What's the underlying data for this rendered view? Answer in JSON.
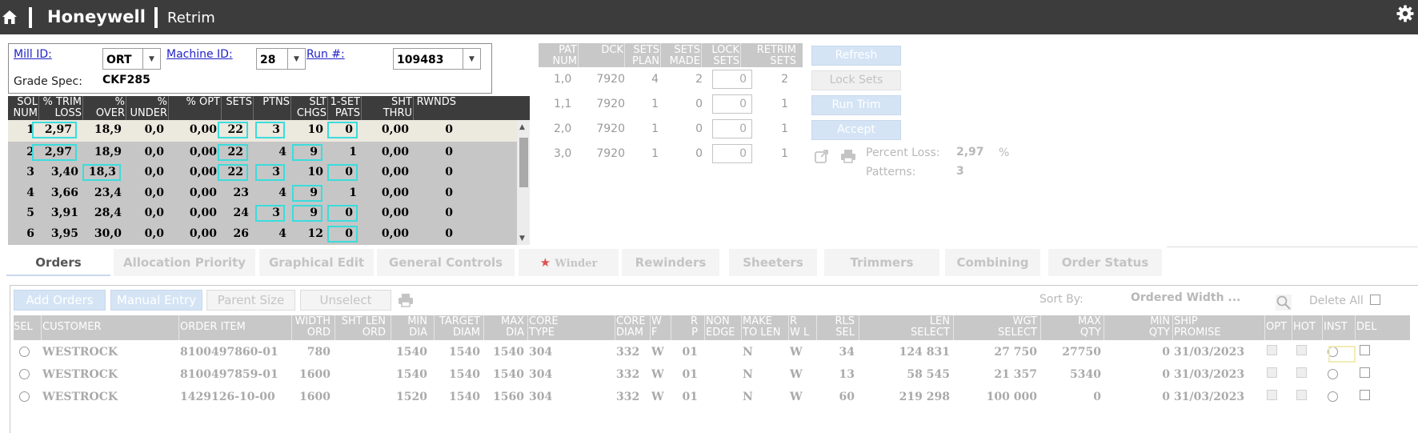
{
  "app": {
    "brand": "Honeywell",
    "title": "Retrim"
  },
  "icons": {
    "home": "home-icon",
    "settings": "gear-icon",
    "export": "export-icon",
    "print": "printer-icon",
    "search": "search-icon"
  },
  "header": {
    "mill_label": "Mill ID:",
    "mill_value": "ORT",
    "machine_label": "Machine ID:",
    "machine_value": "28",
    "run_label": "Run #:",
    "run_value": "109483",
    "grade_label": "Grade Spec:",
    "grade_value": "CKF285"
  },
  "solutions": {
    "columns": [
      {
        "l1": "SOL",
        "l2": "NUM"
      },
      {
        "l1": "% TRIM",
        "l2": "LOSS"
      },
      {
        "l1": "%",
        "l2": "OVER"
      },
      {
        "l1": "%",
        "l2": "UNDER"
      },
      {
        "l1": "% OPT",
        "l2": ""
      },
      {
        "l1": "SETS",
        "l2": ""
      },
      {
        "l1": "PTNS",
        "l2": ""
      },
      {
        "l1": "SLT",
        "l2": "CHGS"
      },
      {
        "l1": "1-SET",
        "l2": "PATS"
      },
      {
        "l1": "SHT",
        "l2": "THRU"
      },
      {
        "l1": "RWNDS",
        "l2": ""
      }
    ],
    "rows": [
      [
        "1",
        "2,97",
        "18,9",
        "0,0",
        "0,00",
        "22",
        "3",
        "10",
        "0",
        "0,00",
        "0"
      ],
      [
        "2",
        "2,97",
        "18,9",
        "0,0",
        "0,00",
        "22",
        "4",
        "9",
        "1",
        "0,00",
        "0"
      ],
      [
        "3",
        "3,40",
        "18,3",
        "0,0",
        "0,00",
        "22",
        "3",
        "10",
        "0",
        "0,00",
        "0"
      ],
      [
        "4",
        "3,66",
        "23,4",
        "0,0",
        "0,00",
        "23",
        "4",
        "9",
        "1",
        "0,00",
        "0"
      ],
      [
        "5",
        "3,91",
        "28,4",
        "0,0",
        "0,00",
        "24",
        "3",
        "9",
        "0",
        "0,00",
        "0"
      ],
      [
        "6",
        "3,95",
        "30,0",
        "0,0",
        "0,00",
        "26",
        "4",
        "12",
        "0",
        "0,00",
        "0"
      ]
    ]
  },
  "patterns": {
    "columns": [
      {
        "l1": "PAT",
        "l2": "NUM"
      },
      {
        "l1": "DCK",
        "l2": ""
      },
      {
        "l1": "SETS",
        "l2": "PLAN"
      },
      {
        "l1": "SETS",
        "l2": "MADE"
      },
      {
        "l1": "LOCK",
        "l2": "SETS"
      },
      {
        "l1": "RETRIM",
        "l2": "SETS"
      }
    ],
    "rows": [
      {
        "num": "1,0",
        "dck": "7920",
        "plan": "4",
        "made": "2",
        "lock": "0",
        "retrim": "2"
      },
      {
        "num": "1,1",
        "dck": "7920",
        "plan": "1",
        "made": "0",
        "lock": "0",
        "retrim": "1"
      },
      {
        "num": "2,0",
        "dck": "7920",
        "plan": "1",
        "made": "0",
        "lock": "0",
        "retrim": "1"
      },
      {
        "num": "3,0",
        "dck": "7920",
        "plan": "1",
        "made": "0",
        "lock": "0",
        "retrim": "1"
      }
    ]
  },
  "actions": {
    "refresh": "Refresh",
    "lock_sets": "Lock Sets",
    "run_trim": "Run Trim",
    "accept": "Accept"
  },
  "stats": {
    "percent_loss_label": "Percent Loss:",
    "percent_loss_value": "2,97",
    "percent_unit": "%",
    "patterns_label": "Patterns:",
    "patterns_value": "3"
  },
  "tabs": [
    "Orders",
    "Allocation Priority",
    "Graphical Edit",
    "General Controls",
    "Winder",
    "Rewinders",
    "Sheeters",
    "Trimmers",
    "Combining",
    "Order Status"
  ],
  "orders_toolbar": {
    "add_orders": "Add Orders",
    "manual_entry": "Manual Entry",
    "parent_size": "Parent Size",
    "unselect": "Unselect",
    "sort_by_label": "Sort By:",
    "sort_by_value": "Ordered Width ...",
    "delete_all": "Delete All"
  },
  "orders": {
    "columns": [
      {
        "l1": "SEL",
        "l2": ""
      },
      {
        "l1": "CUSTOMER",
        "l2": ""
      },
      {
        "l1": "ORDER ITEM",
        "l2": ""
      },
      {
        "l1": "WIDTH",
        "l2": "ORD"
      },
      {
        "l1": "SHT LEN",
        "l2": "ORD"
      },
      {
        "l1": "MIN",
        "l2": "DIA"
      },
      {
        "l1": "TARGET",
        "l2": "DIAM"
      },
      {
        "l1": "MAX",
        "l2": "DIA"
      },
      {
        "l1": "CORE",
        "l2": "TYPE"
      },
      {
        "l1": "CORE",
        "l2": "DIAM"
      },
      {
        "l1": "W",
        "l2": "F"
      },
      {
        "l1": "R",
        "l2": "P"
      },
      {
        "l1": "NON",
        "l2": "EDGE"
      },
      {
        "l1": "MAKE",
        "l2": "TO LEN"
      },
      {
        "l1": "R",
        "l2": "W L"
      },
      {
        "l1": "RLS",
        "l2": "SEL"
      },
      {
        "l1": "LEN",
        "l2": "SELECT"
      },
      {
        "l1": "WGT",
        "l2": "SELECT"
      },
      {
        "l1": "MAX",
        "l2": "QTY"
      },
      {
        "l1": "MIN",
        "l2": "QTY"
      },
      {
        "l1": "SHIP",
        "l2": "PROMISE"
      },
      {
        "l1": "OPT",
        "l2": ""
      },
      {
        "l1": "HOT",
        "l2": ""
      },
      {
        "l1": "INST",
        "l2": ""
      },
      {
        "l1": "DEL",
        "l2": ""
      }
    ],
    "rows": [
      {
        "customer": "WESTROCK",
        "item": "8100497860-01",
        "width": "780",
        "sht": "",
        "min": "1540",
        "target": "1540",
        "max": "1540",
        "core_type": "304",
        "core_diam": "332",
        "wf": "W",
        "rp": "01",
        "non_edge": "",
        "make": "N",
        "rwl": "W",
        "rls": "34",
        "len": "124 831",
        "wgt": "27 750",
        "maxq": "27750",
        "minq": "0",
        "ship": "31/03/2023"
      },
      {
        "customer": "WESTROCK",
        "item": "8100497859-01",
        "width": "1600",
        "sht": "",
        "min": "1540",
        "target": "1540",
        "max": "1540",
        "core_type": "304",
        "core_diam": "332",
        "wf": "W",
        "rp": "01",
        "non_edge": "",
        "make": "N",
        "rwl": "W",
        "rls": "13",
        "len": "58 545",
        "wgt": "21 357",
        "maxq": "5340",
        "minq": "0",
        "ship": "31/03/2023"
      },
      {
        "customer": "WESTROCK",
        "item": "1429126-10-00",
        "width": "1600",
        "sht": "",
        "min": "1520",
        "target": "1540",
        "max": "1560",
        "core_type": "304",
        "core_diam": "332",
        "wf": "W",
        "rp": "01",
        "non_edge": "",
        "make": "N",
        "rwl": "W",
        "rls": "60",
        "len": "219 298",
        "wgt": "100 000",
        "maxq": "0",
        "minq": "0",
        "ship": "31/03/2023"
      }
    ]
  }
}
